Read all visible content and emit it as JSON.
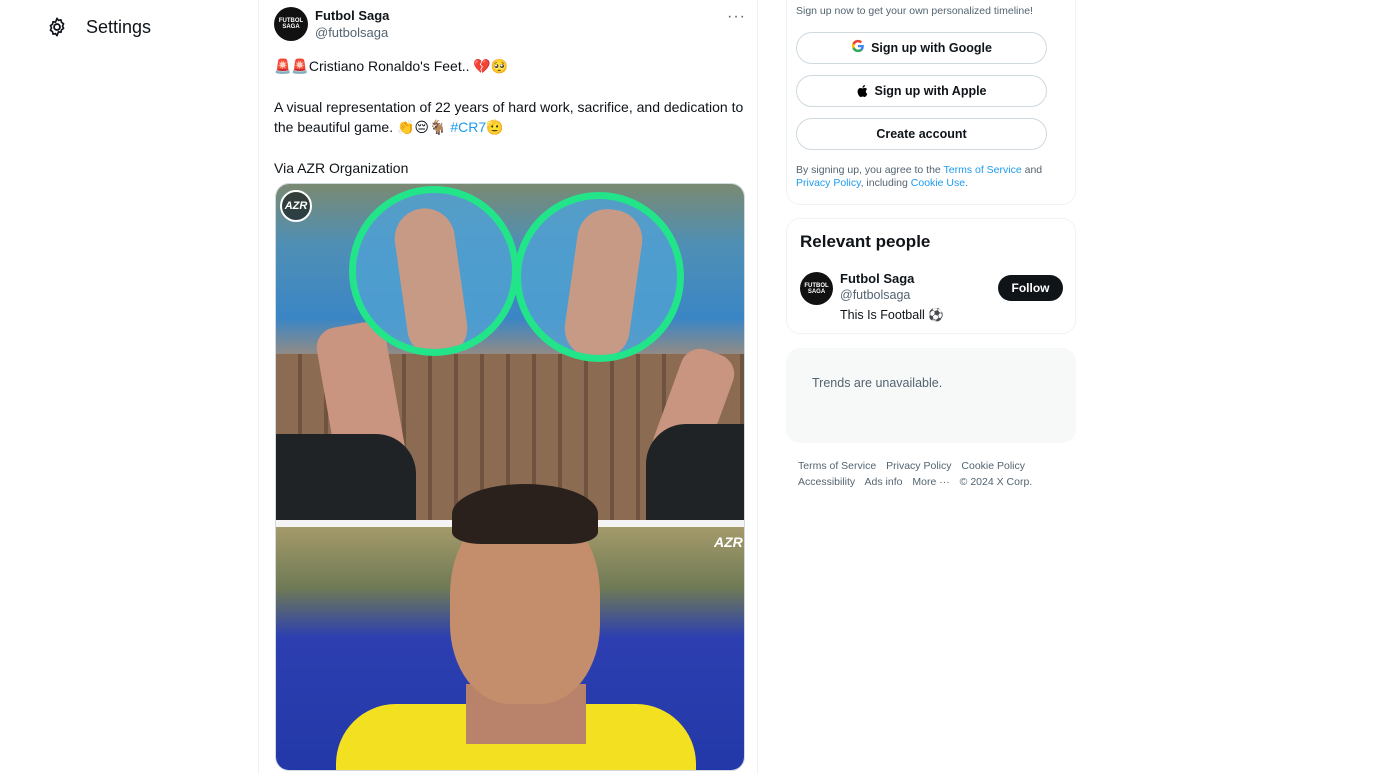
{
  "nav": {
    "settings_label": "Settings",
    "settings_icon": "gear-icon"
  },
  "tweet": {
    "author_name": "Futbol Saga",
    "author_handle": "@futbolsaga",
    "avatar_text": "FUTBOL SAGA",
    "more_label": "···",
    "line1_emoji_prefix": "🚨🚨",
    "line1_text": "Cristiano Ronaldo's Feet..",
    "line1_emoji_suffix": "💔🥺",
    "line2_text": "A visual representation of 22 years of hard work, sacrifice, and dedication to the beautiful game.",
    "line2_emoji": "👏😔🐐",
    "hashtag": "#CR7",
    "hashtag_emoji": "🫡",
    "via_text": "Via AZR Organization",
    "media_watermark": "AZR"
  },
  "signup": {
    "intro": "Sign up now to get your own personalized timeline!",
    "google_label": "Sign up with Google",
    "apple_label": "Sign up with Apple",
    "create_label": "Create account",
    "legal_prefix": "By signing up, you agree to the",
    "terms_link": "Terms of Service",
    "legal_and": "and",
    "privacy_link": "Privacy Policy",
    "legal_including": ", including",
    "cookie_link": "Cookie Use",
    "legal_end": "."
  },
  "relevant_people": {
    "title": "Relevant people",
    "name": "Futbol Saga",
    "handle": "@futbolsaga",
    "bio": "This Is Football ⚽",
    "follow_label": "Follow"
  },
  "trends": {
    "message": "Trends are unavailable."
  },
  "footer": {
    "links": [
      "Terms of Service",
      "Privacy Policy",
      "Cookie Policy",
      "Accessibility",
      "Ads info",
      "More ···",
      "© 2024 X Corp."
    ]
  },
  "colors": {
    "accent": "#1d9bf0",
    "text": "#0f1419",
    "muted": "#536471",
    "highlight_circle": "#22e58a"
  }
}
